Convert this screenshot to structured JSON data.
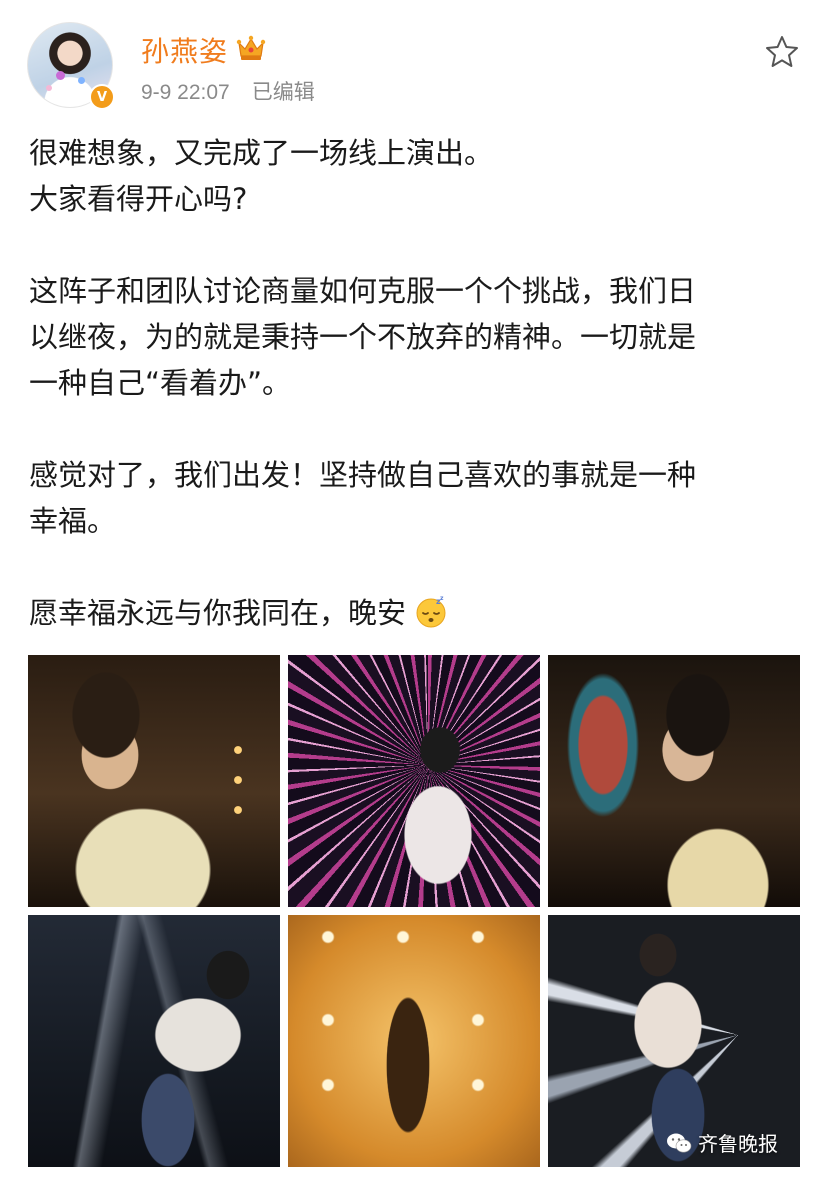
{
  "post": {
    "author": {
      "name": "孙燕姿",
      "verified_badge": "V",
      "avatar": "avatar-photo"
    },
    "timestamp": "9-9 22:07",
    "edited_label": "已编辑",
    "icons": {
      "crown": "crown-icon",
      "favorite": "star-icon",
      "emoji": "sleepy-face-icon"
    },
    "text": {
      "line1": "很难想象，又完成了一场线上演出。",
      "line2": "大家看得开心吗?",
      "para2_line1": "这阵子和团队讨论商量如何克服一个个挑战，我们日",
      "para2_line2": "以继夜，为的就是秉持一个不放弃的精神。一切就是",
      "para2_line3": "一种自己“看着办”。",
      "para3_line1": "感觉对了，我们出发！坚持做自己喜欢的事就是一种",
      "para3_line2": "幸福。",
      "para4_line1": "愿幸福永远与你我同在，晚安"
    },
    "photos_count": 6
  },
  "watermark": {
    "label": "齐鲁晚报",
    "icon": "wechat-icon"
  },
  "colors": {
    "username": "#f07c1d",
    "meta": "#8a8a8a",
    "verified": "#f39c1a",
    "crown": "#f5a623"
  }
}
